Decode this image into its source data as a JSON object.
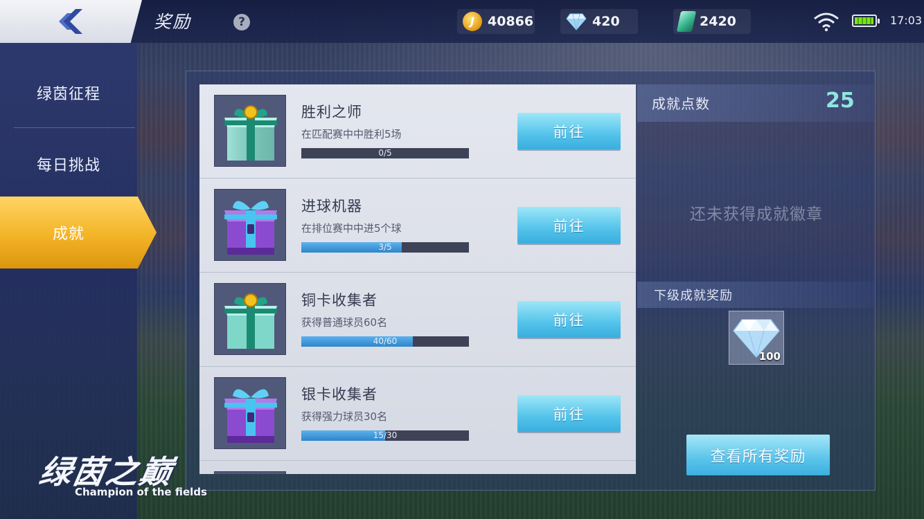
{
  "header": {
    "title": "奖励",
    "help_icon": "question-mark-icon",
    "resources": [
      {
        "name": "coin",
        "icon": "coin-icon",
        "value": "40866"
      },
      {
        "name": "diamond",
        "icon": "diamond-icon",
        "value": "420"
      },
      {
        "name": "ticket",
        "icon": "ticket-icon",
        "value": "2420"
      }
    ],
    "status": {
      "time": "17:03",
      "wifi_icon": "wifi-icon",
      "battery_icon": "battery-icon"
    }
  },
  "sidebar": {
    "items": [
      {
        "label": "绿茵征程",
        "active": false
      },
      {
        "label": "每日挑战",
        "active": false
      },
      {
        "label": "成就",
        "active": true
      }
    ]
  },
  "achievements": [
    {
      "name": "胜利之师",
      "desc": "在匹配赛中中胜利5场",
      "current": 0,
      "total": 5,
      "progress_text": "0/5",
      "button": "前往",
      "icon": "green-gift-box-icon"
    },
    {
      "name": "进球机器",
      "desc": "在排位赛中中进5个球",
      "current": 3,
      "total": 5,
      "progress_text": "3/5",
      "button": "前往",
      "icon": "purple-gift-box-icon"
    },
    {
      "name": "铜卡收集者",
      "desc": "获得普通球员60名",
      "current": 40,
      "total": 60,
      "progress_text": "40/60",
      "button": "前往",
      "icon": "green-gift-box-icon"
    },
    {
      "name": "银卡收集者",
      "desc": "获得强力球员30名",
      "current": 15,
      "total": 30,
      "progress_text": "15/30",
      "button": "前往",
      "icon": "purple-gift-box-icon"
    }
  ],
  "info": {
    "points_label": "成就点数",
    "points_value": "25",
    "no_badge_text": "还未获得成就徽章",
    "next_reward_label": "下级成就奖励",
    "next_reward": {
      "icon": "diamond-icon",
      "count": "100"
    },
    "view_all_button": "查看所有奖励"
  },
  "logo": {
    "cn": "绿茵之巅",
    "en": "Champion of the fields"
  },
  "colors": {
    "accent_blue": "#53c3ea",
    "active_tab": "#f3b326",
    "points_value": "#8fe6e0"
  }
}
